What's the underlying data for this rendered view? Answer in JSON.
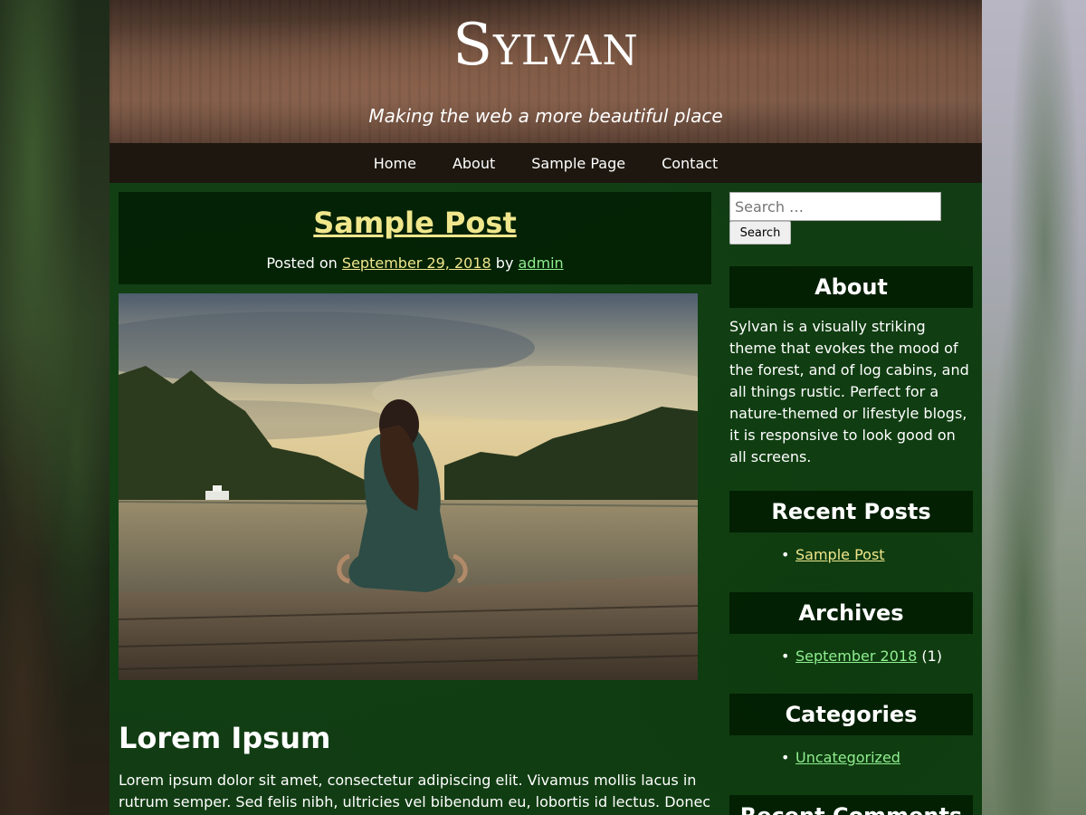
{
  "site": {
    "title": "Sylvan",
    "tagline": "Making the web a more beautiful place"
  },
  "nav": {
    "items": [
      {
        "label": "Home"
      },
      {
        "label": "About"
      },
      {
        "label": "Sample Page"
      },
      {
        "label": "Contact"
      }
    ]
  },
  "post": {
    "title": "Sample Post",
    "meta_prefix": "Posted on",
    "date": "September 29, 2018",
    "meta_by": "by",
    "author": "admin",
    "heading": "Lorem Ipsum",
    "body": "Lorem ipsum dolor sit amet, consectetur adipiscing elit. Vivamus mollis lacus in rutrum semper. Sed felis nibh, ultricies vel bibendum eu, lobortis id lectus. Donec"
  },
  "sidebar": {
    "search": {
      "placeholder": "Search …",
      "button_label": "Search"
    },
    "about": {
      "title": "About",
      "text": "Sylvan is a visually striking theme that evokes the mood of the forest, and of log cabins, and all things rustic. Perfect for a nature-themed or lifestyle blogs, it is responsive to look good on all screens."
    },
    "recent_posts": {
      "title": "Recent Posts",
      "items": [
        {
          "label": "Sample Post"
        }
      ]
    },
    "archives": {
      "title": "Archives",
      "items": [
        {
          "label": "September 2018",
          "count": "(1)"
        }
      ]
    },
    "categories": {
      "title": "Categories",
      "items": [
        {
          "label": "Uncategorized"
        }
      ]
    },
    "recent_comments": {
      "title": "Recent Comments"
    }
  },
  "colors": {
    "link_yellow": "#f0e68c",
    "link_green": "#90ee90",
    "content_bg": "#123d14"
  }
}
